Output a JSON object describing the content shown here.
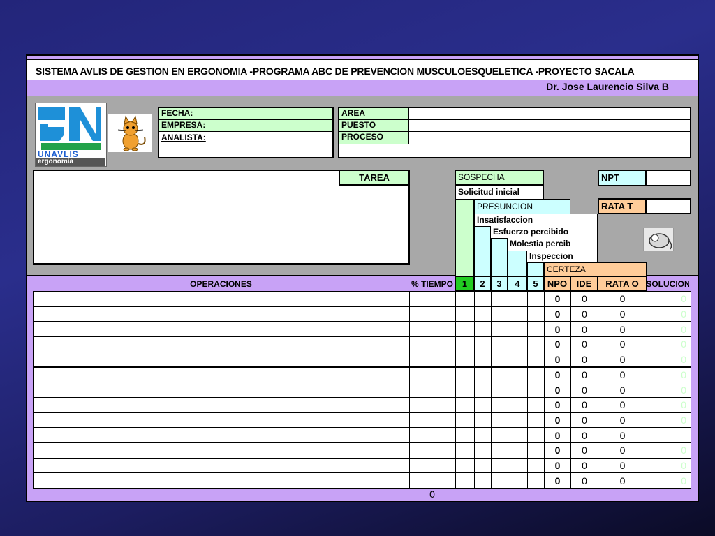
{
  "header": {
    "title": "SISTEMA AVLIS DE GESTION EN ERGONOMIA  -PROGRAMA ABC  DE PREVENCION  MUSCULOESQUELETICA  -PROYECTO SACALA",
    "author": "Dr. Jose Laurencio Silva B"
  },
  "logo": {
    "line1": "UNAVLIS",
    "line2": "ergonomia"
  },
  "info": {
    "fecha_label": "FECHA:",
    "empresa_label": "EMPRESA:",
    "analista_label": "ANALISTA:",
    "area_label": "AREA",
    "puesto_label": "PUESTO",
    "proceso_label": "PROCESO"
  },
  "tarea_label": "TAREA",
  "levels": {
    "sospecha": "SOSPECHA",
    "solicitud": "Solicitud inicial",
    "presuncion": "PRESUNCION",
    "insatisfaccion": "Insatisfaccion",
    "esfuerzo": "Esfuerzo percibido",
    "molestia": "Molestia percib",
    "inspeccion": "Inspeccion",
    "certeza": "CERTEZA"
  },
  "npt_label": "NPT",
  "rata_t_label": "RATA T",
  "columns": {
    "operaciones": "OPERACIONES",
    "tiempo": "% TIEMPO",
    "c1": "1",
    "c2": "2",
    "c3": "3",
    "c4": "4",
    "c5": "5",
    "npo": "NPO",
    "ide": "IDE",
    "rata_o": "RATA O",
    "solucion": "SOLUCION"
  },
  "rows": [
    {
      "npo": "0",
      "ide": "0",
      "rata": "0",
      "sol": "0"
    },
    {
      "npo": "0",
      "ide": "0",
      "rata": "0",
      "sol": "0"
    },
    {
      "npo": "0",
      "ide": "0",
      "rata": "0",
      "sol": "0"
    },
    {
      "npo": "0",
      "ide": "0",
      "rata": "0",
      "sol": "0"
    },
    {
      "npo": "0",
      "ide": "0",
      "rata": "0",
      "sol": "0"
    },
    {
      "npo": "0",
      "ide": "0",
      "rata": "0",
      "sol": "0"
    },
    {
      "npo": "0",
      "ide": "0",
      "rata": "0",
      "sol": "0"
    },
    {
      "npo": "0",
      "ide": "0",
      "rata": "0",
      "sol": "0"
    },
    {
      "npo": "0",
      "ide": "0",
      "rata": "0",
      "sol": "0"
    },
    {
      "npo": "0",
      "ide": "0",
      "rata": "0",
      "sol": ""
    },
    {
      "npo": "0",
      "ide": "0",
      "rata": "0",
      "sol": "0"
    },
    {
      "npo": "0",
      "ide": "0",
      "rata": "0",
      "sol": "0"
    },
    {
      "npo": "0",
      "ide": "0",
      "rata": "0",
      "sol": "0"
    }
  ],
  "footer_total": "0",
  "icons": {
    "cat": "cat-icon",
    "mouse": "mouse-icon"
  }
}
